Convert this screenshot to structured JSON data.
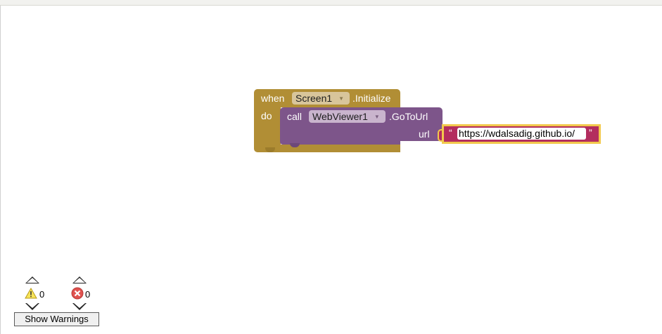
{
  "event_block": {
    "when_label": "when",
    "component": "Screen1",
    "event_name": ".Initialize",
    "do_label": "do",
    "color": "#b18e35"
  },
  "call_block": {
    "call_label": "call",
    "component": "WebViewer1",
    "method_name": ".GoToUrl",
    "arg_label": "url",
    "color": "#7d558a"
  },
  "text_block": {
    "open_quote": "“",
    "close_quote": "”",
    "value": "https://wdalsadig.github.io/",
    "color": "#b32d5e",
    "highlight": "#f2c94c"
  },
  "indicators": {
    "warning_icon": "warning-icon",
    "warning_count": "0",
    "error_icon": "error-icon",
    "error_count": "0",
    "show_warnings_label": "Show Warnings"
  }
}
